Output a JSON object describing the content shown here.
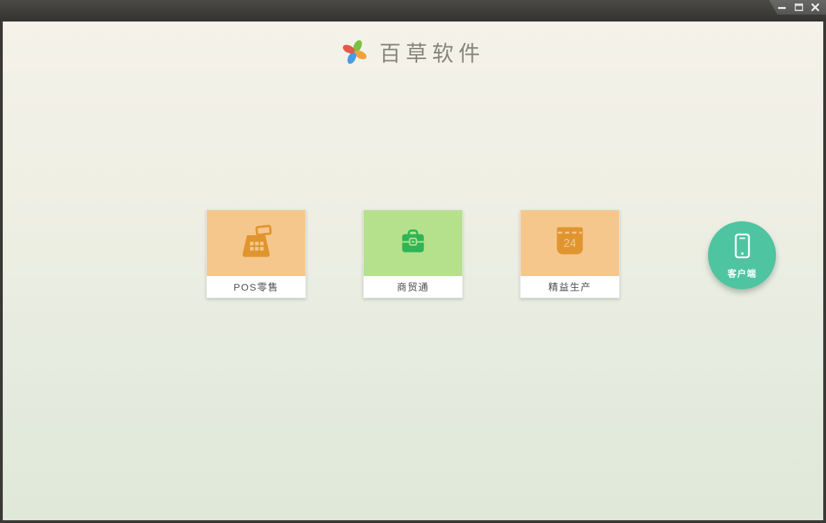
{
  "window": {
    "title": "",
    "controls": [
      {
        "icon": "minimize-icon"
      },
      {
        "icon": "maximize-icon"
      },
      {
        "icon": "close-icon"
      }
    ],
    "titlebar_color": "#403f3c",
    "frame_color": "#3a3936"
  },
  "header": {
    "logo_icon": "pinwheel-logo-icon",
    "logo_colors": {
      "top": "#7cc142",
      "right": "#f0a33c",
      "bottom": "#4a9be4",
      "left": "#e25b4d"
    },
    "app_title": "百草软件"
  },
  "products": [
    {
      "label": "POS零售",
      "icon": "cash-register-icon",
      "tile_color": "#f6c78d",
      "icon_color": "#e0952f"
    },
    {
      "label": "商贸通",
      "icon": "briefcase-icon",
      "tile_color": "#b5e18c",
      "icon_color": "#2fb457"
    },
    {
      "label": "精益生产",
      "icon": "calendar-icon",
      "calendar_day": "24",
      "tile_color": "#f6c78d",
      "icon_color": "#e0952f"
    }
  ],
  "client_button": {
    "label": "客户端",
    "icon": "smartphone-icon",
    "color": "#4fc4a1"
  },
  "background": {
    "gradient_top": "#f4f2e9",
    "gradient_bottom": "#dfe8d9"
  }
}
